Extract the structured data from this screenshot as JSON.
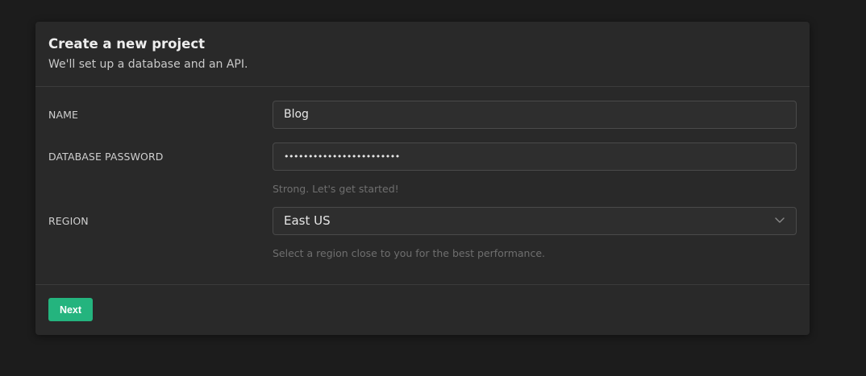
{
  "header": {
    "title": "Create a new project",
    "subtitle": "We'll set up a database and an API."
  },
  "form": {
    "name": {
      "label": "NAME",
      "value": "Blog"
    },
    "password": {
      "label": "DATABASE PASSWORD",
      "masked_value": "••••••••••••••••••••••••",
      "hint": "Strong. Let's get started!"
    },
    "region": {
      "label": "REGION",
      "selected": "East US",
      "hint": "Select a region close to you for the best performance.",
      "icon": "chevron-down-icon"
    }
  },
  "footer": {
    "next_label": "Next"
  },
  "colors": {
    "background": "#1c1c1c",
    "card": "#292929",
    "accent": "#24b47e",
    "hint_text": "#6f6f6f"
  }
}
